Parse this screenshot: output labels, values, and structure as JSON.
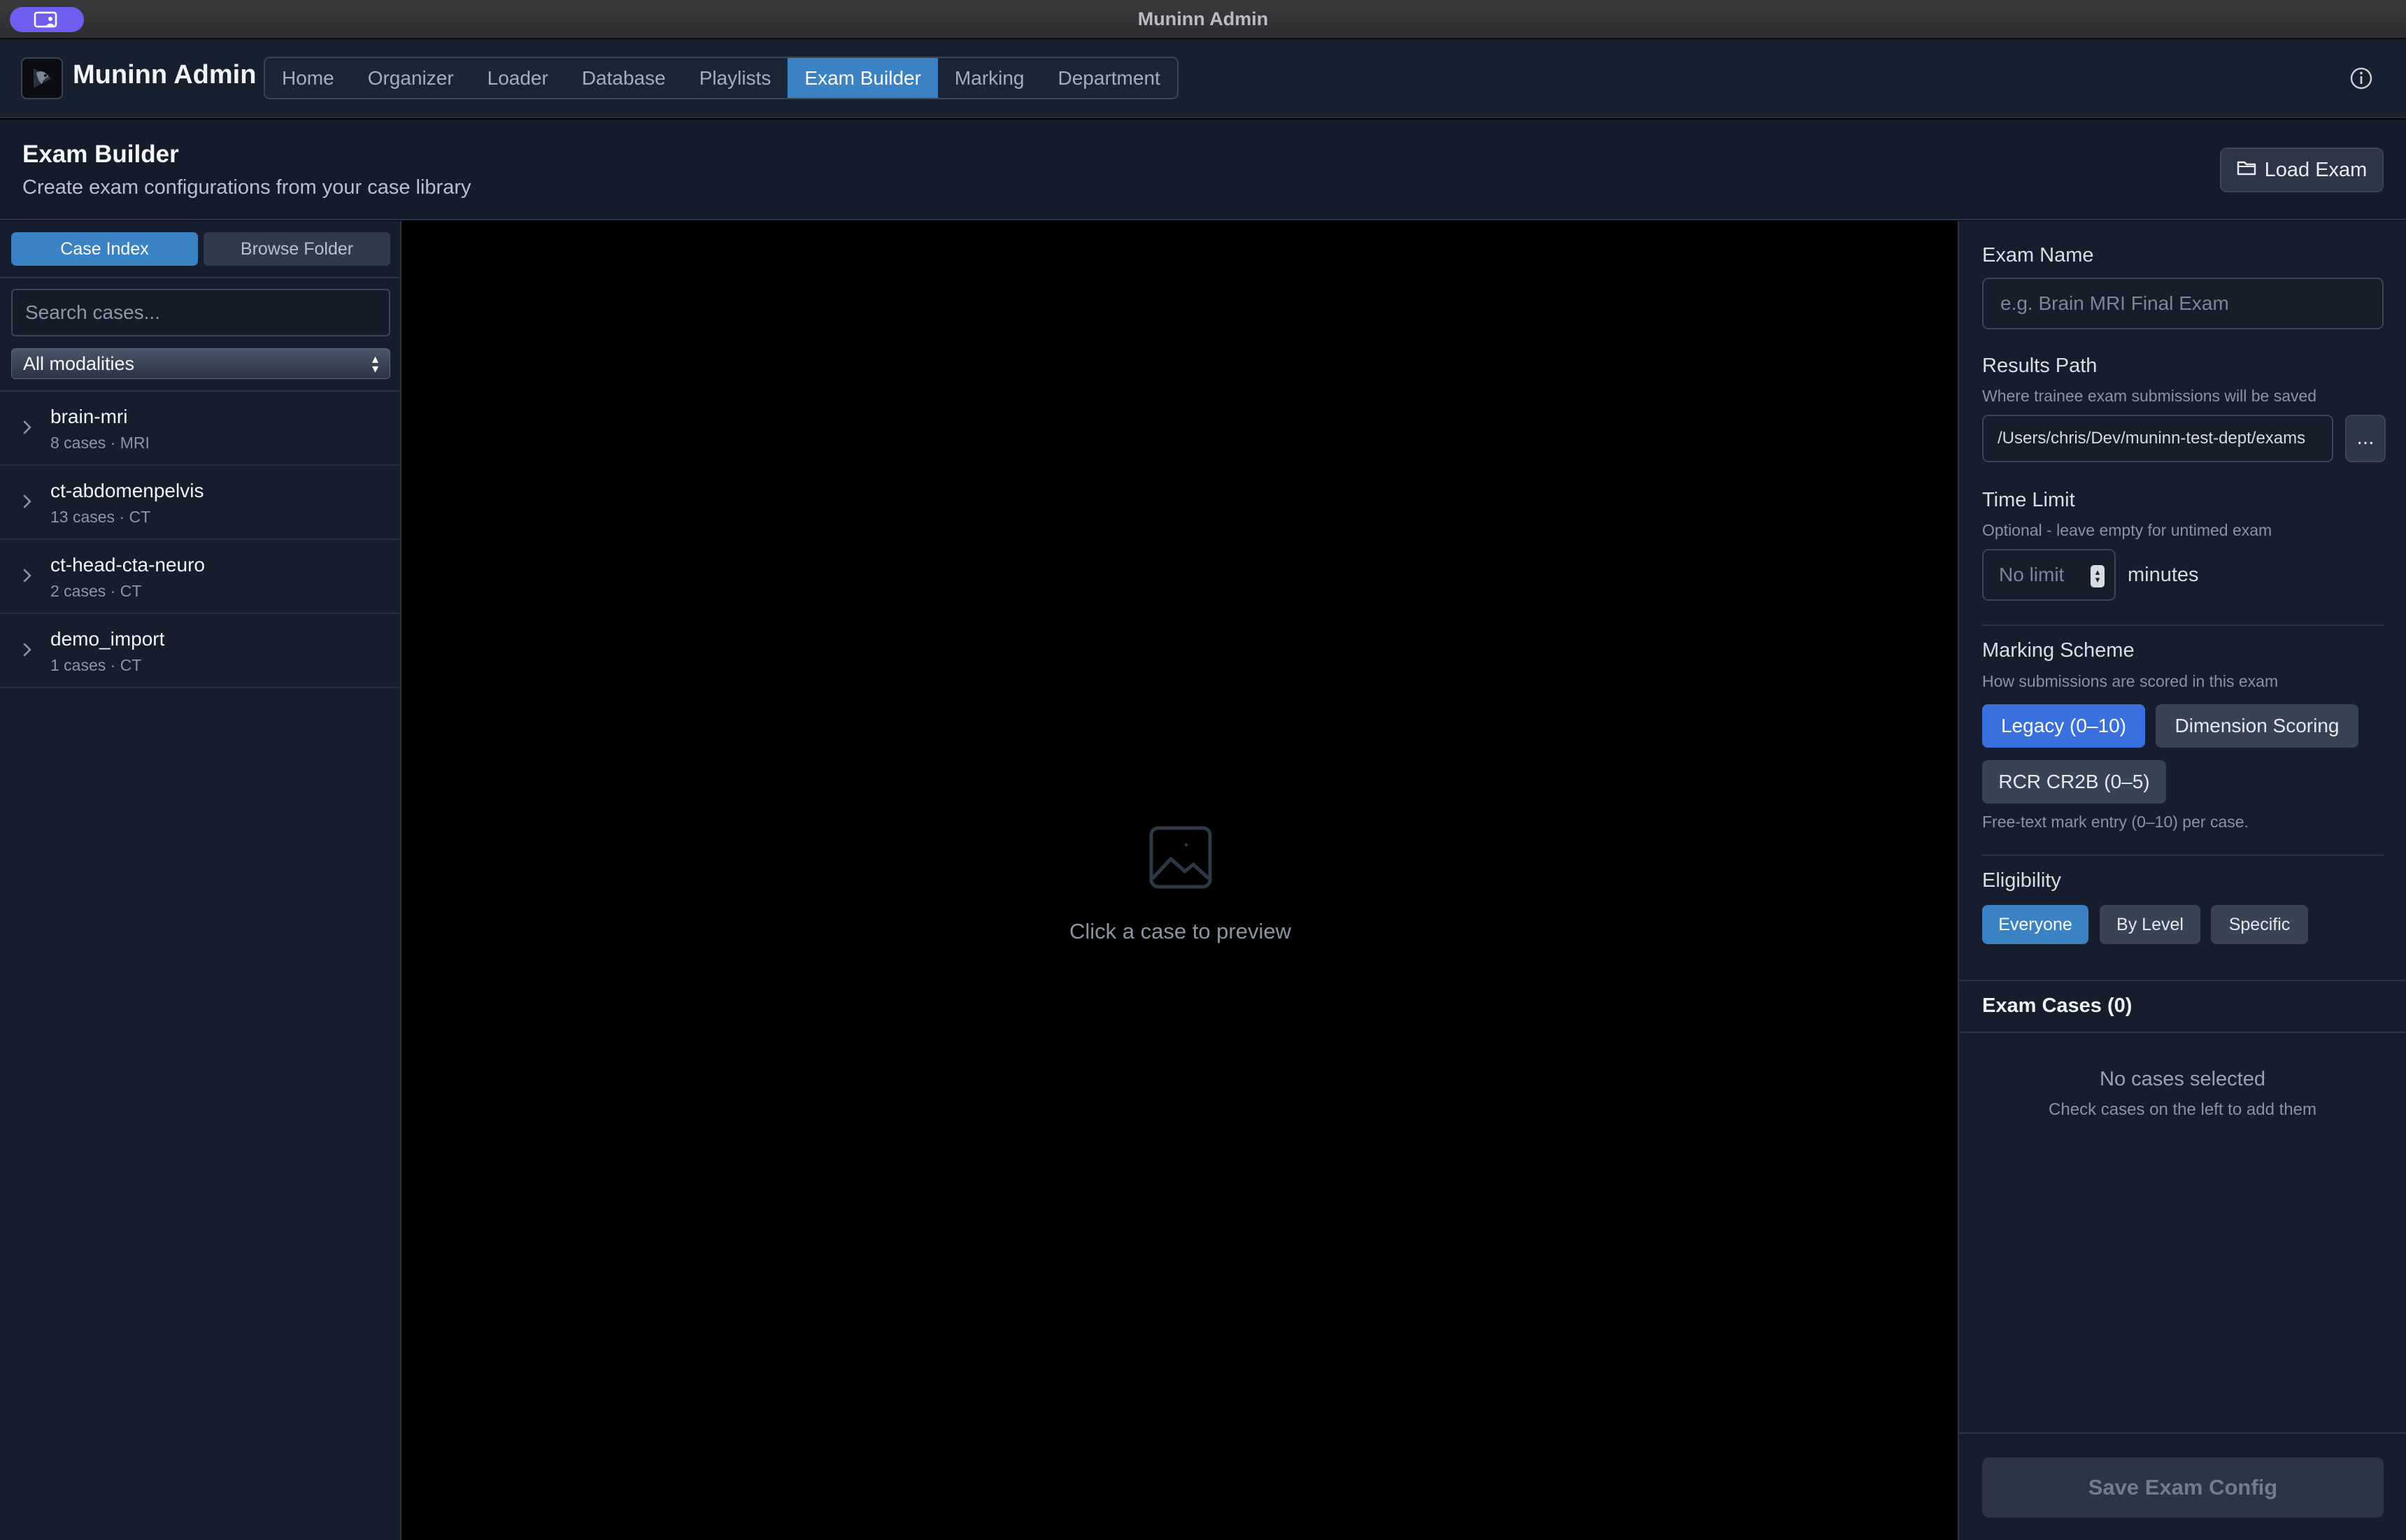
{
  "window": {
    "title": "Muninn Admin"
  },
  "app": {
    "name": "Muninn Admin",
    "nav": [
      {
        "label": "Home"
      },
      {
        "label": "Organizer"
      },
      {
        "label": "Loader"
      },
      {
        "label": "Database"
      },
      {
        "label": "Playlists"
      },
      {
        "label": "Exam Builder",
        "active": true
      },
      {
        "label": "Marking"
      },
      {
        "label": "Department"
      }
    ]
  },
  "page": {
    "title": "Exam Builder",
    "subtitle": "Create exam configurations from your case library",
    "load_button": "Load Exam"
  },
  "left": {
    "tabs": {
      "case_index": "Case Index",
      "browse_folder": "Browse Folder"
    },
    "search_placeholder": "Search cases...",
    "modality_filter": "All modalities",
    "cases": [
      {
        "name": "brain-mri",
        "meta": "8 cases · MRI"
      },
      {
        "name": "ct-abdomenpelvis",
        "meta": "13 cases · CT"
      },
      {
        "name": "ct-head-cta-neuro",
        "meta": "2 cases · CT"
      },
      {
        "name": "demo_import",
        "meta": "1 cases · CT"
      }
    ]
  },
  "preview": {
    "empty_text": "Click a case to preview"
  },
  "form": {
    "exam_name": {
      "label": "Exam Name",
      "placeholder": "e.g. Brain MRI Final Exam"
    },
    "results_path": {
      "label": "Results Path",
      "hint": "Where trainee exam submissions will be saved",
      "value": "/Users/chris/Dev/muninn-test-dept/exams",
      "browse_label": "..."
    },
    "time_limit": {
      "label": "Time Limit",
      "hint": "Optional - leave empty for untimed exam",
      "placeholder": "No limit",
      "unit": "minutes"
    },
    "marking_scheme": {
      "label": "Marking Scheme",
      "hint": "How submissions are scored in this exam",
      "options": [
        "Legacy (0–10)",
        "Dimension Scoring",
        "RCR CR2B (0–5)"
      ],
      "selected": "Legacy (0–10)",
      "description": "Free-text mark entry (0–10) per case."
    },
    "eligibility": {
      "label": "Eligibility",
      "options": [
        "Everyone",
        "By Level",
        "Specific"
      ],
      "selected": "Everyone"
    },
    "exam_cases": {
      "title": "Exam Cases (0)",
      "empty_title": "No cases selected",
      "empty_hint": "Check cases on the left to add them"
    },
    "save_button": "Save Exam Config"
  },
  "colors": {
    "accent": "#3a82c4",
    "primary_button": "#3a6fe0",
    "panel_bg": "#161e2e",
    "titlebar_pill": "#6e5ff0"
  },
  "icons": [
    "display-user-icon",
    "app-logo-icon",
    "info-icon",
    "folder-icon",
    "chevron-right-icon",
    "image-placeholder-icon",
    "select-arrows-icon",
    "stepper-icon"
  ]
}
